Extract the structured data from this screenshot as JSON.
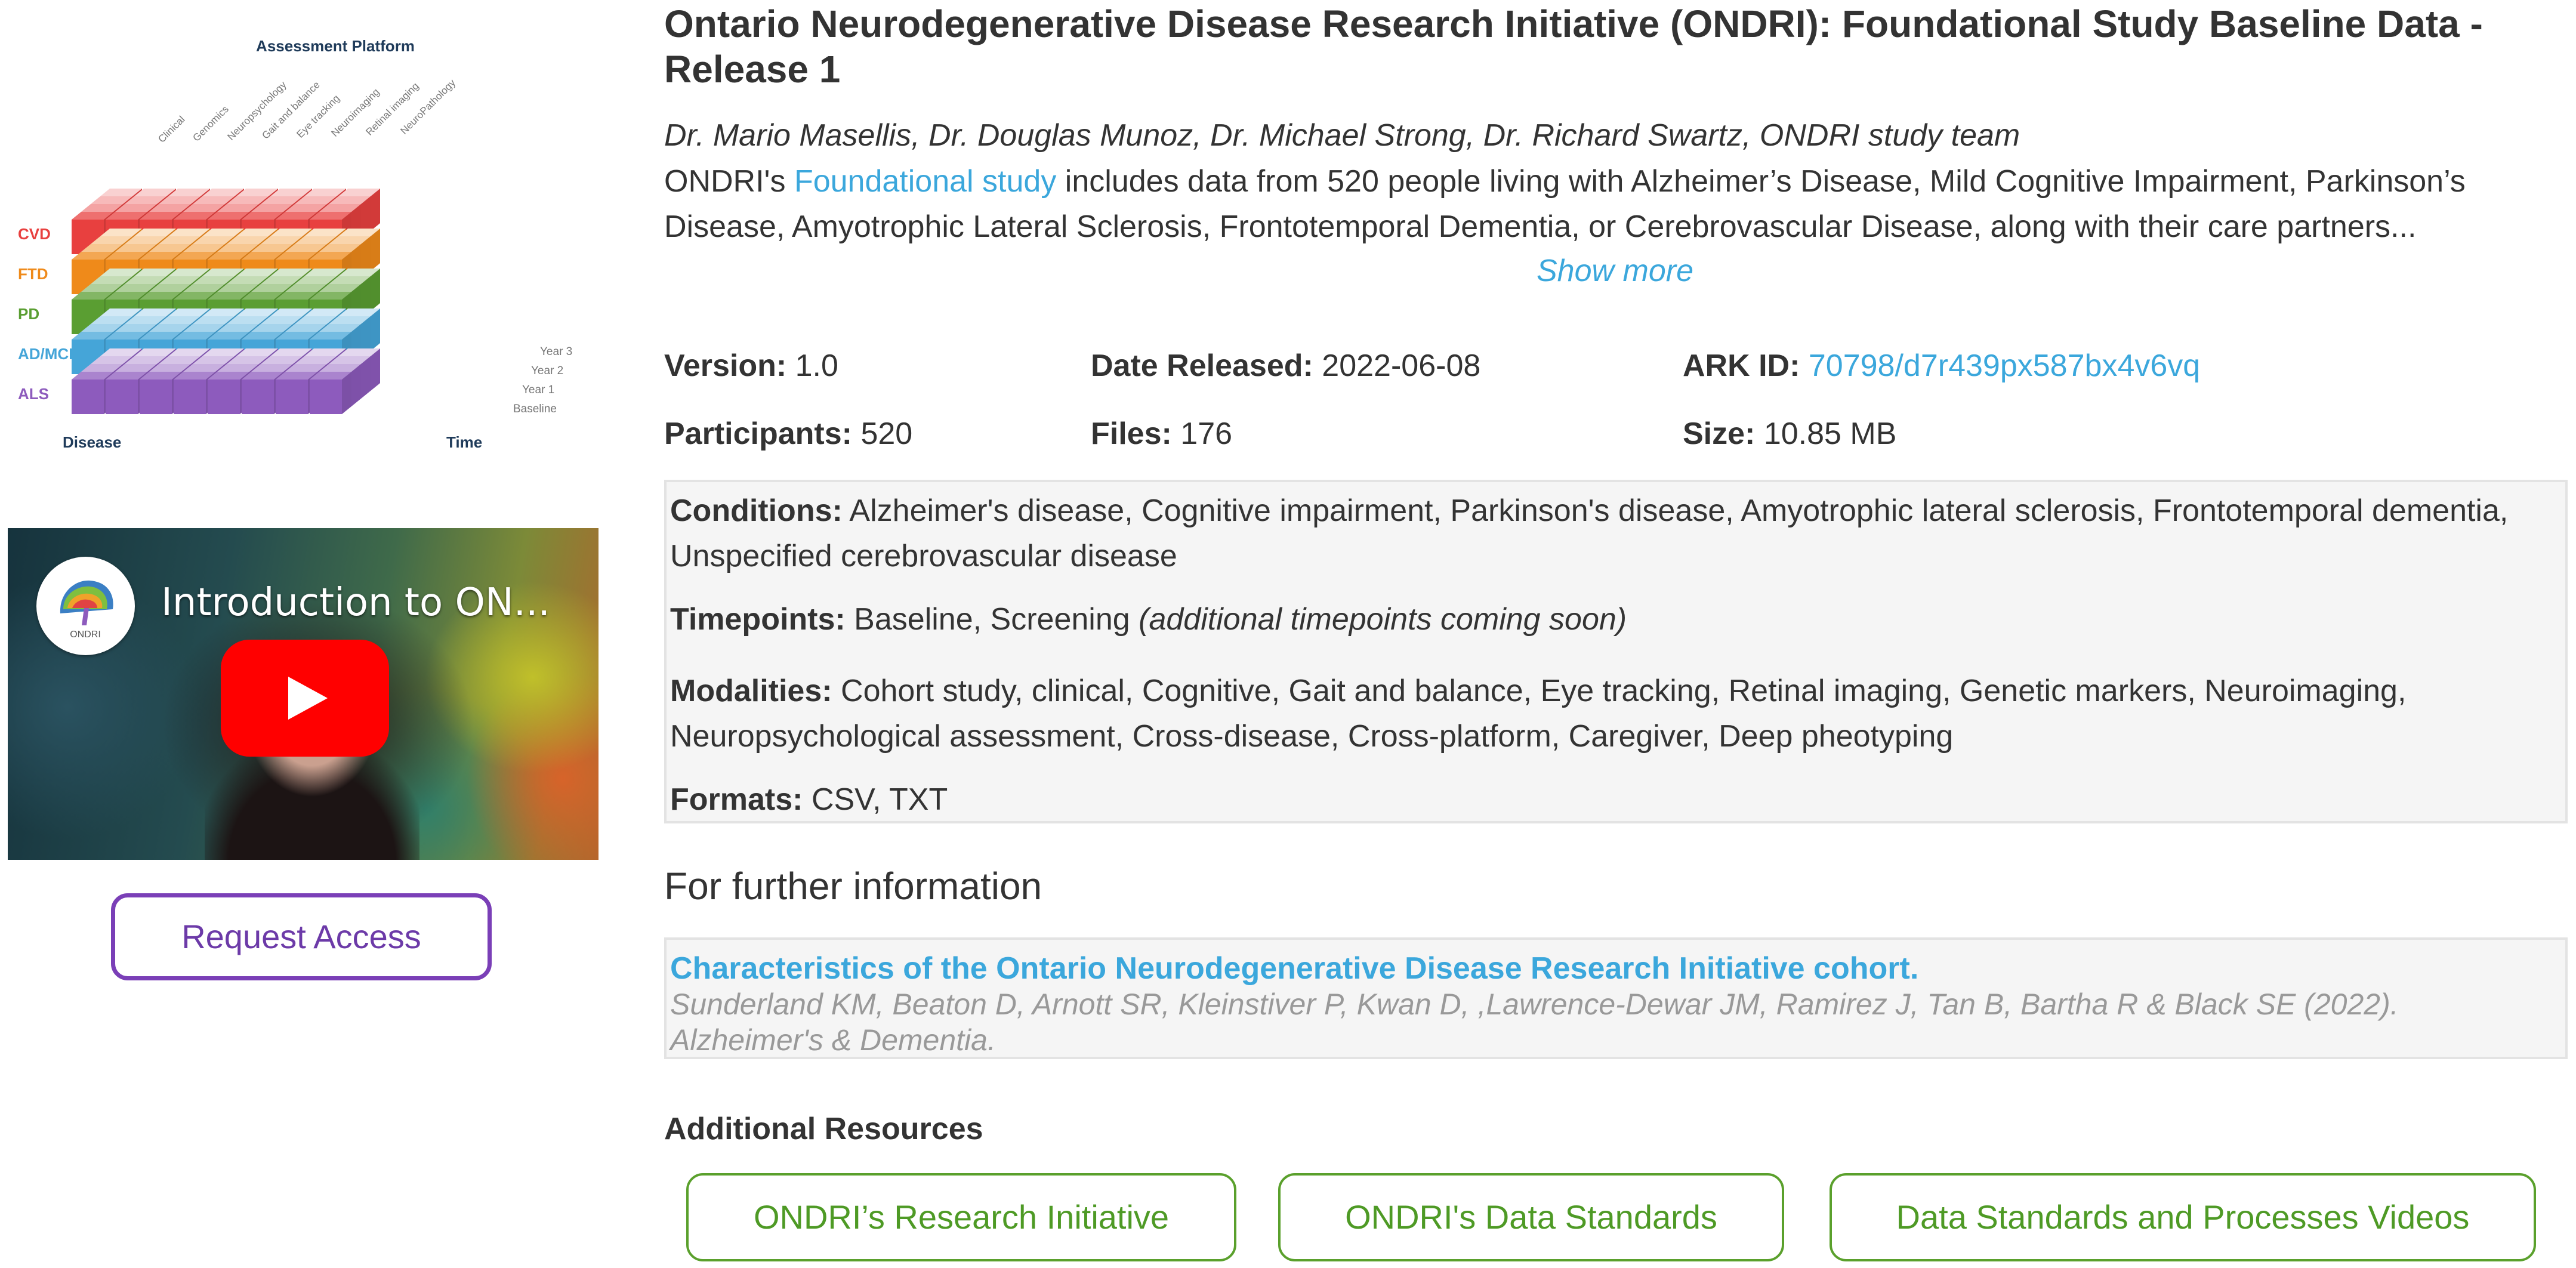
{
  "figure": {
    "title": "Assessment Platform",
    "platforms": [
      "Clinical",
      "Genomics",
      "Neuropsychology",
      "Gait and balance",
      "Eye tracking",
      "Neuroimaging",
      "Retinal imaging",
      "NeuroPathology"
    ],
    "diseases": [
      {
        "label": "CVD",
        "color": "#e8403f"
      },
      {
        "label": "FTD",
        "color": "#ef8a1a"
      },
      {
        "label": "PD",
        "color": "#5a9e32"
      },
      {
        "label": "AD/MCI",
        "color": "#45a5d8"
      },
      {
        "label": "ALS",
        "color": "#8d5bbd"
      }
    ],
    "timepoints": [
      "Year 3",
      "Year 2",
      "Year 1",
      "Baseline"
    ],
    "disease_axis_label": "Disease",
    "time_axis_label": "Time"
  },
  "video": {
    "title": "Introduction to ON..."
  },
  "request_access_label": "Request Access",
  "dataset": {
    "title": "Ontario Neurodegenerative Disease Research Initiative (ONDRI): Foundational Study Baseline Data - Release 1",
    "authors": "Dr. Mario Masellis, Dr. Douglas Munoz, Dr. Michael Strong, Dr. Richard Swartz, ONDRI study team",
    "description_prefix": "ONDRI's ",
    "description_link": "Foundational study",
    "description_suffix": " includes data from 520 people living with Alzheimer’s Disease, Mild Cognitive Impairment, Parkinson’s Disease, Amyotrophic Lateral Sclerosis, Frontotemporal Dementia, or Cerebrovascular Disease, along with their care partners...",
    "show_more_label": "Show more"
  },
  "meta": {
    "version_label": "Version:",
    "version": "1.0",
    "date_label": "Date Released:",
    "date": "2022-06-08",
    "ark_label": "ARK ID:",
    "ark": "70798/d7r439px587bx4v6vq",
    "participants_label": "Participants:",
    "participants": "520",
    "files_label": "Files:",
    "files": "176",
    "size_label": "Size:",
    "size": "10.85 MB"
  },
  "details": {
    "conditions_label": "Conditions:",
    "conditions": "Alzheimer's disease, Cognitive impairment, Parkinson's disease, Amyotrophic lateral sclerosis, Frontotemporal dementia, Unspecified cerebrovascular disease",
    "timepoints_label": "Timepoints:",
    "timepoints": "Baseline, Screening",
    "timepoints_note": "(additional timepoints coming soon)",
    "modalities_label": "Modalities:",
    "modalities": "Cohort study, clinical, Cognitive, Gait and balance, Eye tracking, Retinal imaging, Genetic markers, Neuroimaging, Neuropsychological assessment, Cross-disease, Cross-platform, Caregiver, Deep pheotyping",
    "formats_label": "Formats:",
    "formats": "CSV, TXT"
  },
  "further_info": {
    "heading": "For further information",
    "ref_title": "Characteristics of the Ontario Neurodegenerative Disease Research Initiative cohort.",
    "ref_citation": "Sunderland KM, Beaton D, Arnott SR, Kleinstiver P, Kwan D, ,Lawrence-Dewar JM, Ramirez J, Tan B, Bartha R & Black SE (2022). Alzheimer's & Dementia."
  },
  "additional_resources": {
    "heading": "Additional Resources",
    "buttons": [
      "ONDRI’s Research Initiative",
      "ONDRI's Data Standards",
      "Data Standards and Processes Videos"
    ]
  },
  "colors": {
    "link": "#3ba7dc",
    "request_access_border": "#7a3fb7",
    "resource_button": "#5aa02c"
  },
  "icons": {
    "video_play": "play-icon",
    "video_channel": "ondri-logo-icon"
  }
}
